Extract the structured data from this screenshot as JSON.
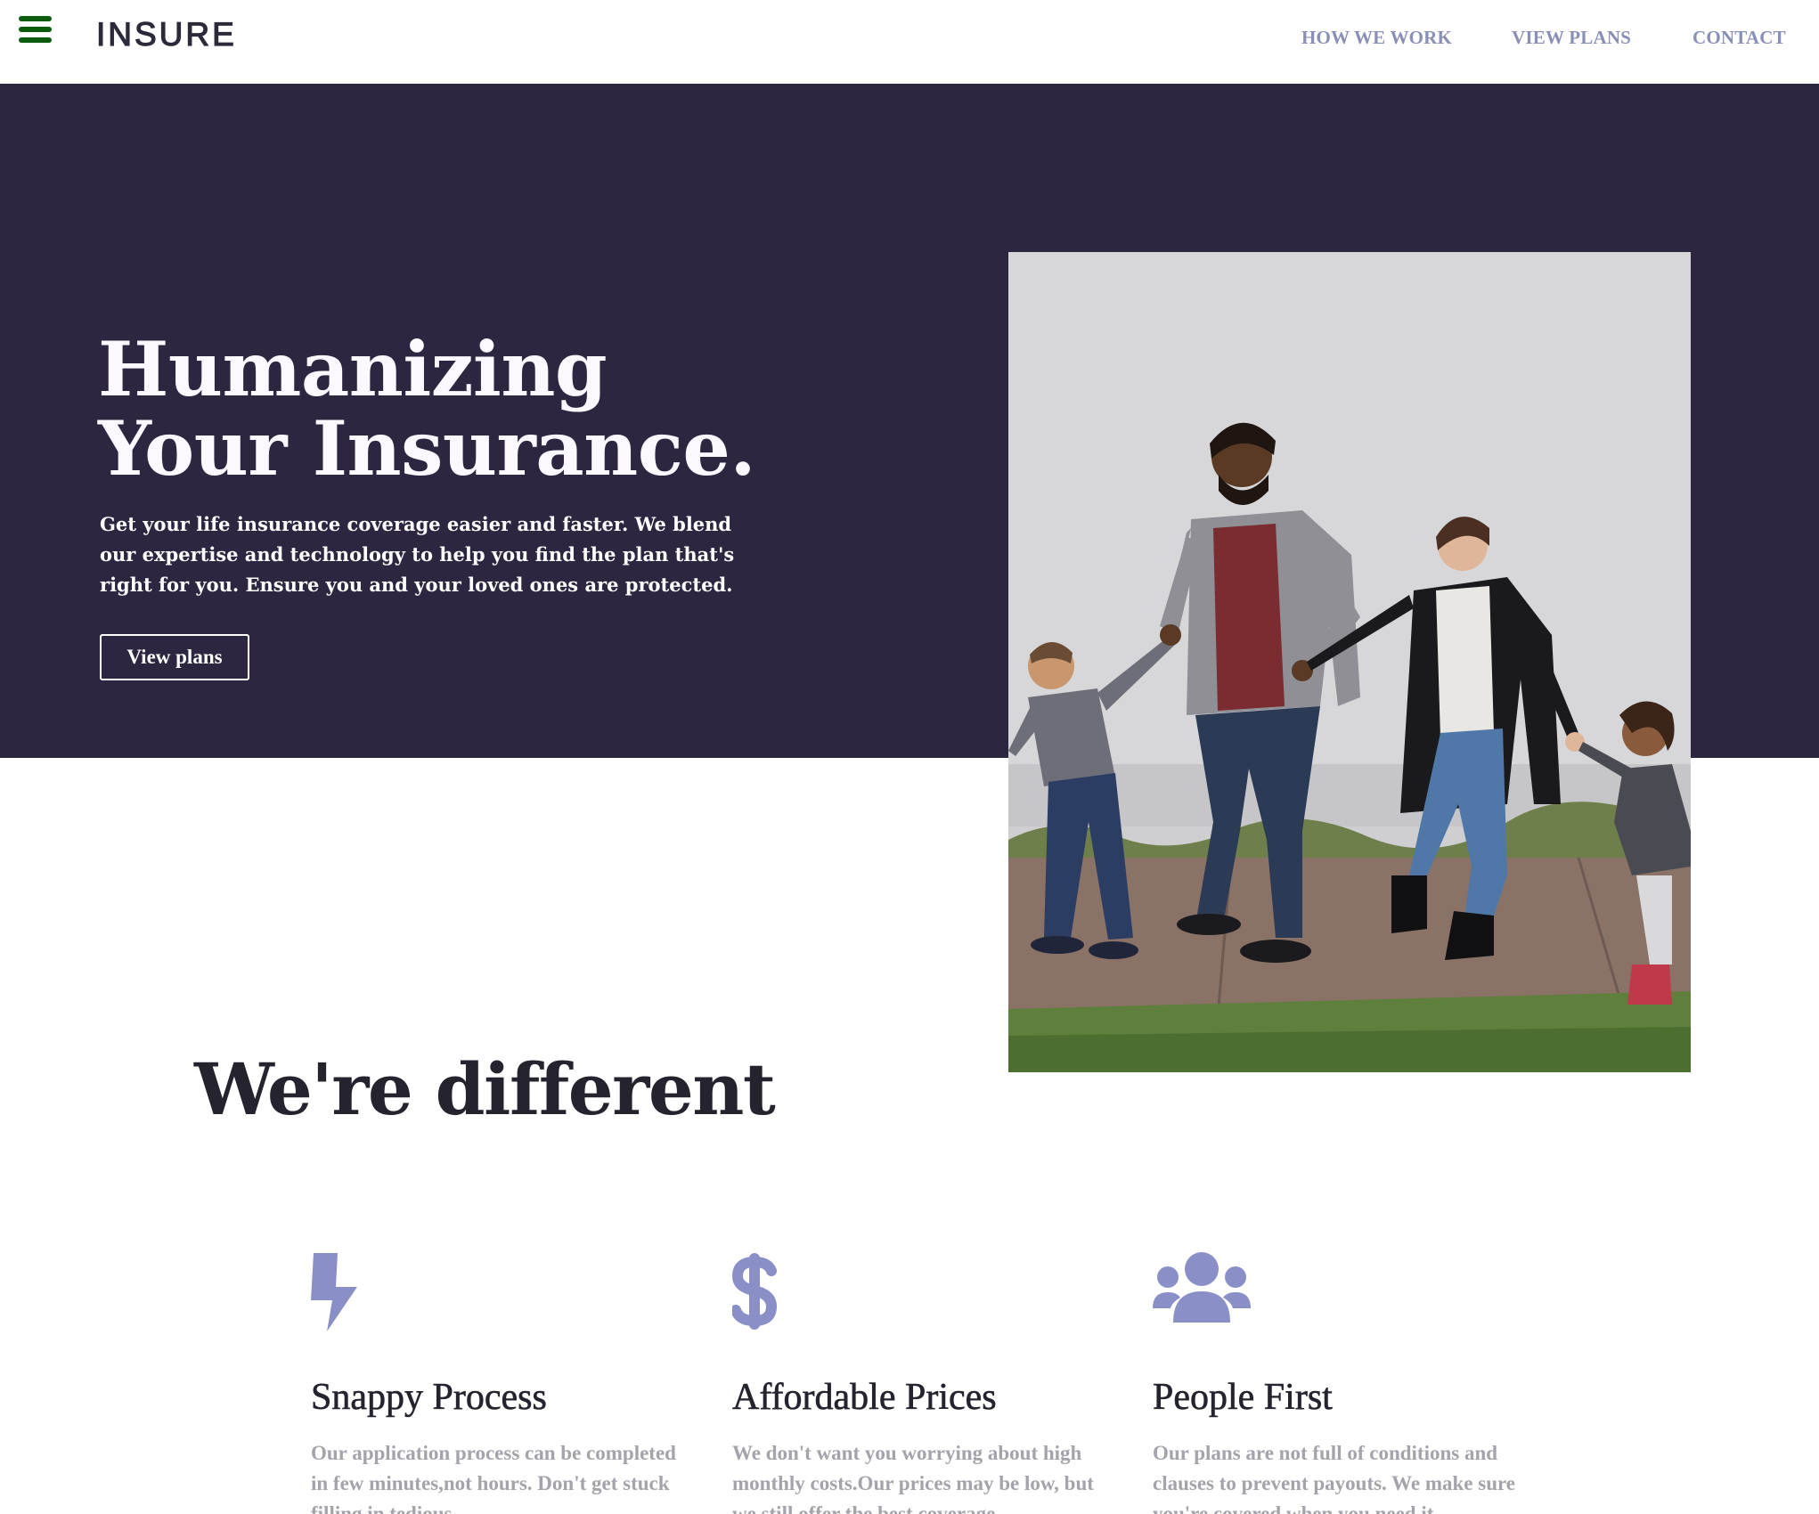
{
  "header": {
    "menu_icon": "hamburger-menu-icon",
    "logo": "INSURE",
    "nav": [
      "HOW WE WORK",
      "VIEW PLANS",
      "CONTACT"
    ]
  },
  "hero": {
    "title_line1": "Humanizing",
    "title_line2": "Your Insurance.",
    "description": "Get your life insurance coverage easier and faster. We blend our expertise and technology to help you find the plan that's right for you. Ensure you and your loved ones are protected.",
    "button_label": "View plans",
    "image_alt": "Family of four holding hands and walking"
  },
  "section": {
    "title": "We're different"
  },
  "features": [
    {
      "icon": "lightning-bolt-icon",
      "title": "Snappy Process",
      "text": "Our application process can be completed in few minutes,not hours. Don't get stuck filling in tedious"
    },
    {
      "icon": "dollar-icon",
      "title": "Affordable Prices",
      "text": "We don't want you worrying about high monthly costs.Our prices may be low, but we still offer the best coverage"
    },
    {
      "icon": "users-icon",
      "title": "People First",
      "text": "Our plans are not full of conditions and clauses to prevent payouts. We make sure you're covered when you need it"
    }
  ],
  "colors": {
    "hero_bg": "#2d2641",
    "accent_icon": "#8b8fc8",
    "nav_text": "#8a8fb8",
    "menu_icon": "#0b5c0e",
    "heading_dark": "#24232e",
    "body_muted": "#a3a3ab"
  }
}
